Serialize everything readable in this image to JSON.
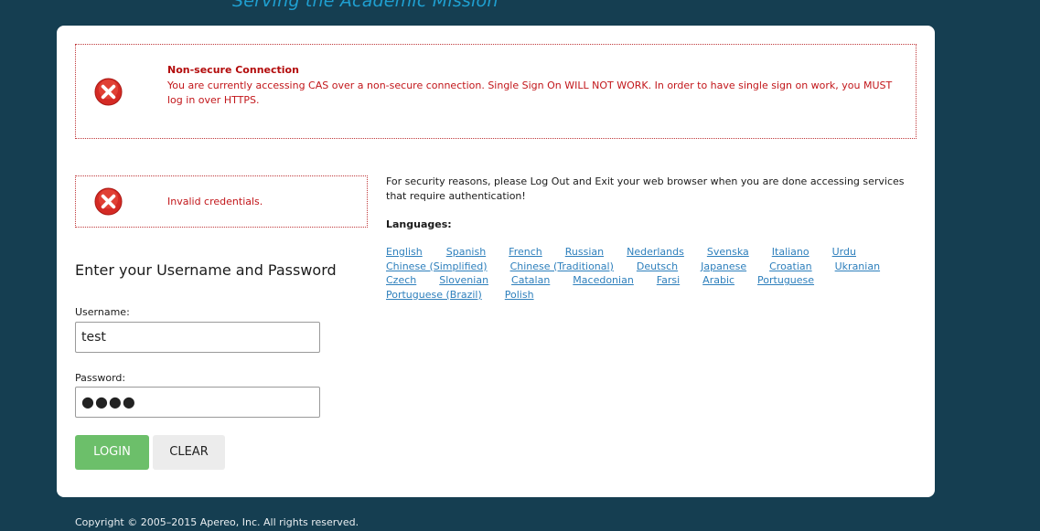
{
  "header": {
    "tagline": "Serving the Academic Mission"
  },
  "alerts": {
    "non_secure": {
      "title": "Non-secure Connection",
      "message": "You are currently accessing CAS over a non-secure connection. Single Sign On WILL NOT WORK. In order to have single sign on work, you MUST log in over HTTPS.",
      "icon": "error-x-icon"
    },
    "invalid": {
      "message": "Invalid credentials.",
      "icon": "error-x-icon"
    },
    "error_color": "#c2161a"
  },
  "login": {
    "heading": "Enter your Username and Password",
    "username_label": "Username:",
    "username_value": "test",
    "password_label": "Password:",
    "password_mask": "●●●●",
    "login_button": "LOGIN",
    "clear_button": "CLEAR",
    "login_color": "#6cbf6a"
  },
  "info": {
    "security_notice": "For security reasons, please Log Out and Exit your web browser when you are done accessing services that require authentication!",
    "languages_title": "Languages:",
    "languages": [
      [
        "English",
        "Spanish",
        "French",
        "Russian",
        "Nederlands",
        "Svenska",
        "Italiano",
        "Urdu"
      ],
      [
        "Chinese (Simplified)",
        "Chinese (Traditional)",
        "Deutsch",
        "Japanese",
        "Croatian",
        "Ukranian"
      ],
      [
        "Czech",
        "Slovenian",
        "Catalan",
        "Macedonian",
        "Farsi",
        "Arabic",
        "Portuguese"
      ],
      [
        "Portuguese (Brazil)",
        "Polish"
      ]
    ],
    "link_color": "#2d7fbc"
  },
  "footer": {
    "copyright": "Copyright © 2005–2015 Apereo, Inc. All rights reserved."
  }
}
